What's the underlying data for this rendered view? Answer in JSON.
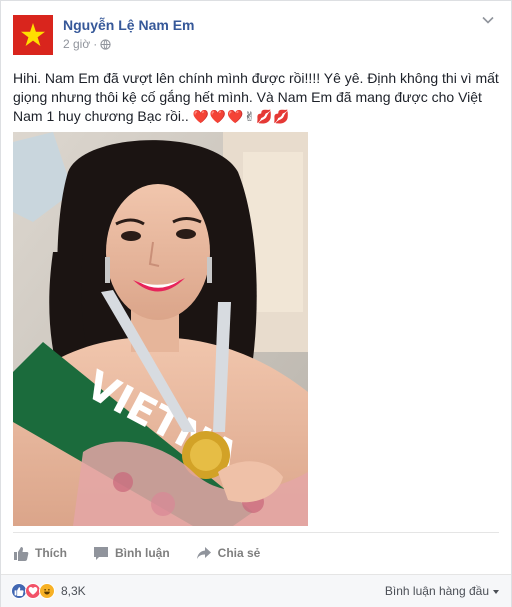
{
  "post": {
    "author": "Nguyễn Lệ Nam Em",
    "time": "2 giờ",
    "privacy_icon": "globe-icon",
    "text": "Hihi. Nam Em đã vượt lên chính mình được rồi!!!! Yê yê. Định không thi vì mất giọng nhưng thôi kệ cố gắng hết mình. Và Nam Em đã mang được cho Việt Nam 1 huy chương Bạc rồi..",
    "emojis": "❤️❤️❤️✌💋💋",
    "photo_sash_text": "VIETNA"
  },
  "actions": {
    "like_label": "Thích",
    "comment_label": "Bình luận",
    "share_label": "Chia sẻ"
  },
  "footer": {
    "reaction_icons": [
      "like-icon",
      "love-icon",
      "haha-icon"
    ],
    "reaction_count": "8,3K",
    "sort_label": "Bình luận hàng đầu"
  },
  "colors": {
    "author": "#365899",
    "like_blue": "#4267b2",
    "love_red": "#f25268",
    "haha_yellow": "#f7b125",
    "flag_red": "#d9251d",
    "flag_star": "#ffde00",
    "sash_green": "#1b6b3c"
  }
}
